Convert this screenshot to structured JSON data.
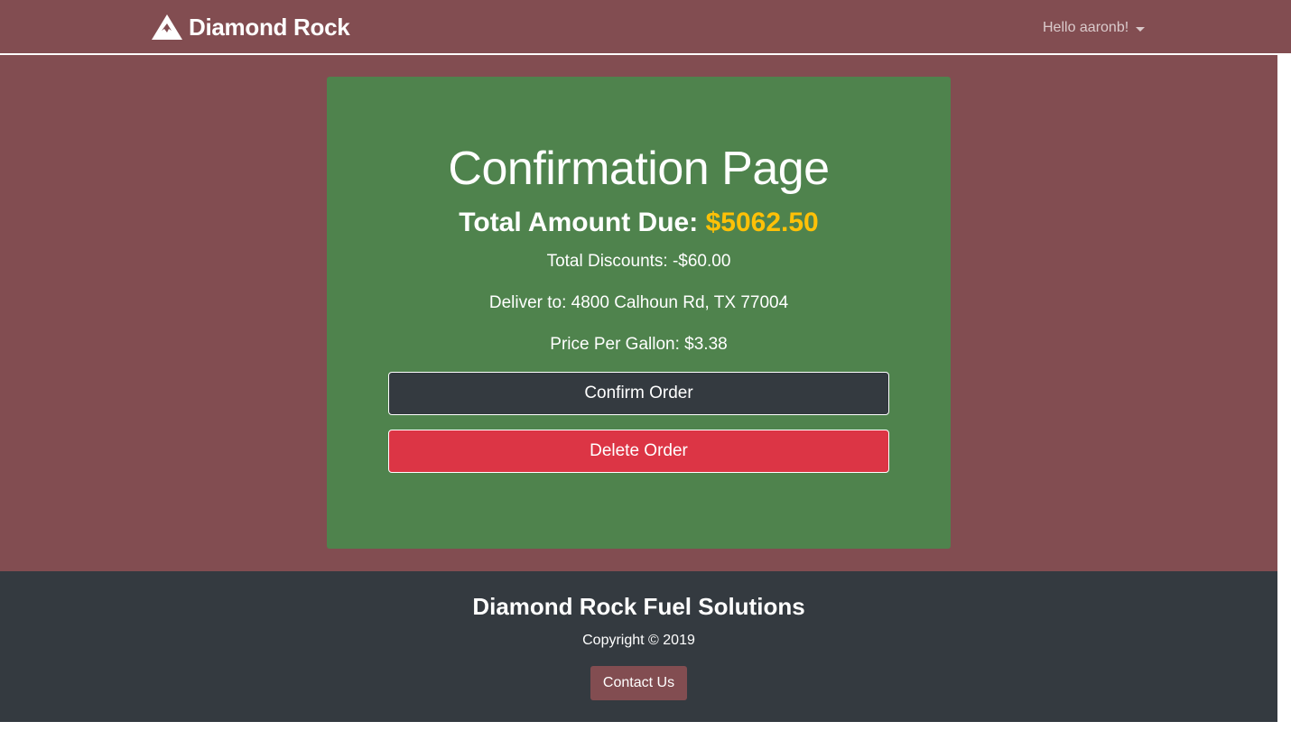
{
  "navbar": {
    "brand_name": "Diamond Rock",
    "brand_icon": "mountain-icon",
    "user_greeting": "Hello aaronb!",
    "user_menu_icon": "caret-down-icon"
  },
  "confirmation": {
    "title": "Confirmation Page",
    "total_label": "Total Amount Due:",
    "total_amount": "$5062.50",
    "discounts": "Total Discounts: -$60.00",
    "deliver_to": "Deliver to: 4800 Calhoun Rd, TX 77004",
    "price_per_gallon": "Price Per Gallon: $3.38",
    "confirm_button": "Confirm Order",
    "delete_button": "Delete Order"
  },
  "footer": {
    "title": "Diamond Rock Fuel Solutions",
    "copyright": "Copyright © 2019",
    "contact_button": "Contact Us"
  },
  "colors": {
    "brand_maroon": "#824d51",
    "card_green": "#4f834d",
    "amount_yellow": "#ffc107",
    "dark": "#343a40",
    "danger_red": "#dc3545"
  }
}
